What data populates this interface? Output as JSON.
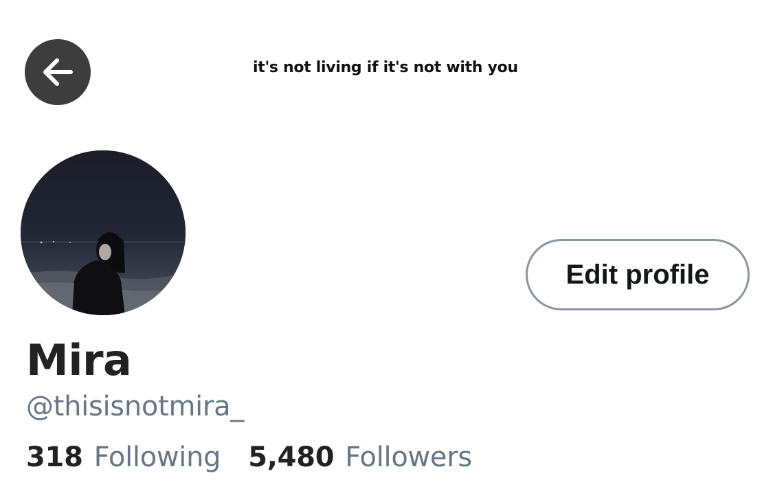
{
  "header": {
    "banner_text": "it's not living if it's not with you",
    "back_icon": "arrow-left-icon"
  },
  "profile": {
    "avatar_description": "avatar",
    "edit_button_label": "Edit profile",
    "display_name": "Mira",
    "handle": "@thisisnotmira_"
  },
  "stats": {
    "following_count": "318",
    "following_label": "Following",
    "followers_count": "5,480",
    "followers_label": "Followers"
  },
  "colors": {
    "back_button_bg": "#3d3d3d",
    "secondary_text": "#687684",
    "button_border": "#8a959e"
  }
}
